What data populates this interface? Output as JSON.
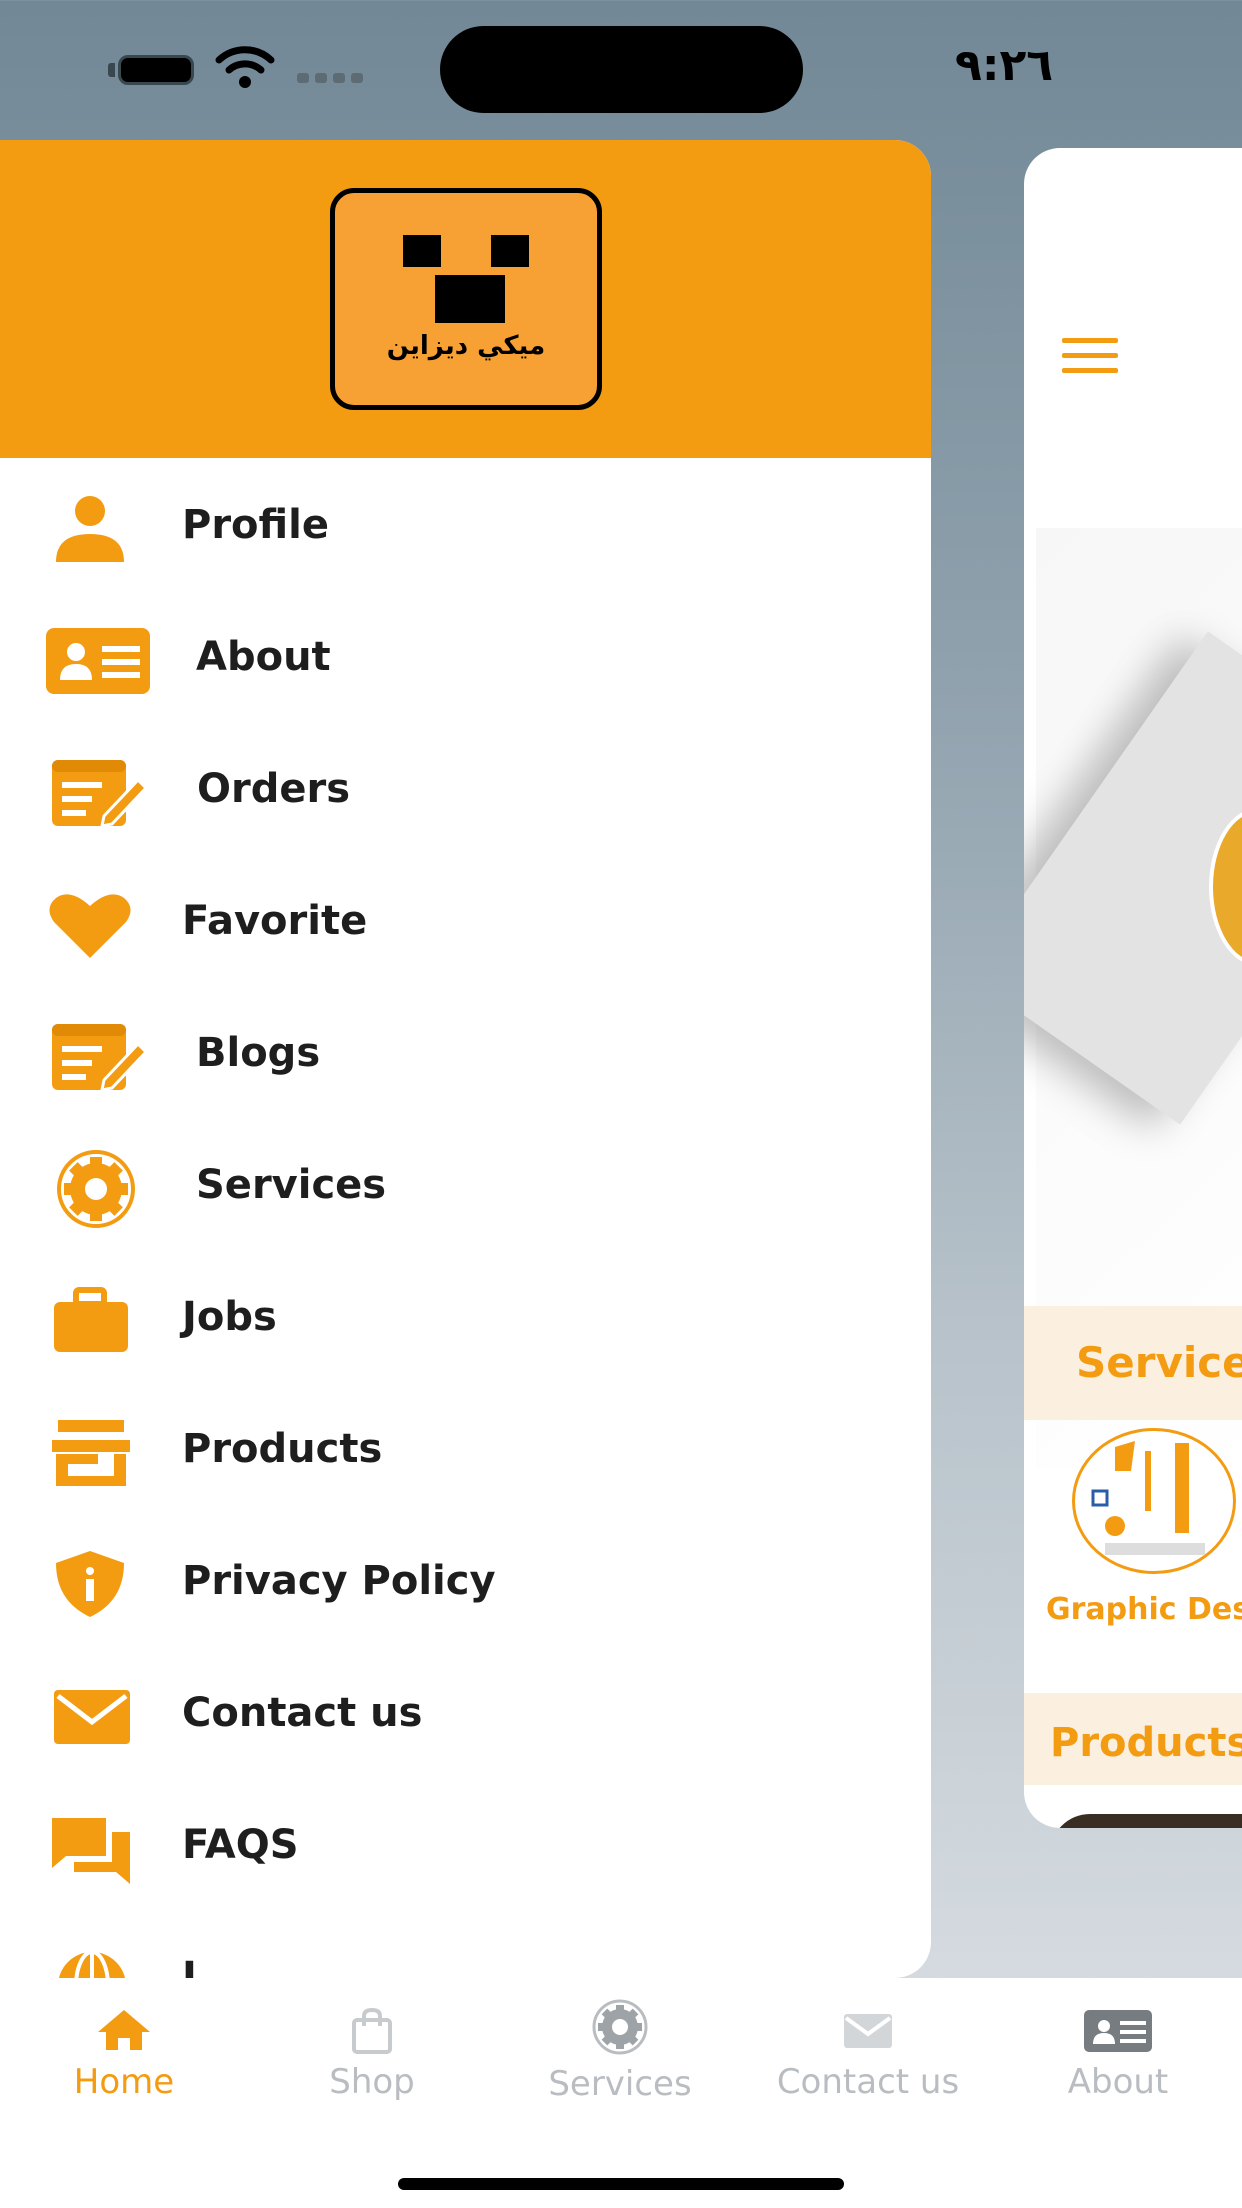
{
  "status_bar": {
    "time": "٩:٢٦"
  },
  "drawer": {
    "logo_text": "ميكي ديزاين",
    "items": [
      {
        "label": "Profile",
        "icon": "person-icon"
      },
      {
        "label": "About",
        "icon": "id-card-icon"
      },
      {
        "label": "Orders",
        "icon": "edit-list-icon"
      },
      {
        "label": "Favorite",
        "icon": "heart-icon"
      },
      {
        "label": "Blogs",
        "icon": "edit-list-icon"
      },
      {
        "label": "Services",
        "icon": "gear-icon"
      },
      {
        "label": "Jobs",
        "icon": "briefcase-icon"
      },
      {
        "label": "Products",
        "icon": "store-icon"
      },
      {
        "label": "Privacy Policy",
        "icon": "shield-icon"
      },
      {
        "label": "Contact us",
        "icon": "mail-icon"
      },
      {
        "label": "FAQS",
        "icon": "chat-icon"
      },
      {
        "label": "L",
        "icon": "globe-icon"
      }
    ]
  },
  "background_page": {
    "services_title": "Service",
    "graphic_label": "Graphic Desig",
    "products_title": "Products"
  },
  "tabbar": {
    "tabs": [
      {
        "label": "Home",
        "active": true,
        "icon": "home-icon"
      },
      {
        "label": "Shop",
        "active": false,
        "icon": "bag-icon"
      },
      {
        "label": "Services",
        "active": false,
        "icon": "gear-icon"
      },
      {
        "label": "Contact us",
        "active": false,
        "icon": "mail-icon"
      },
      {
        "label": "About",
        "active": false,
        "icon": "id-card-icon"
      }
    ]
  },
  "colors": {
    "accent": "#f39c12",
    "inactive": "#b9bdc1",
    "text": "#1e1e1e"
  }
}
